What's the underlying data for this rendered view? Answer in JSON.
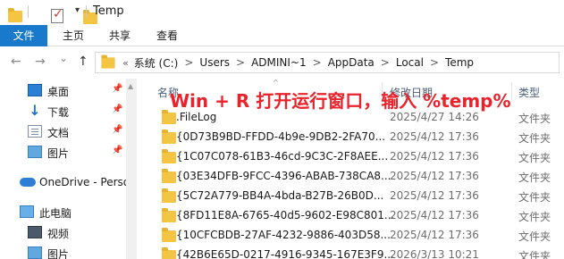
{
  "window": {
    "title": "Temp",
    "qat_dropdown": "▾"
  },
  "ribbon": {
    "tabs": [
      "文件",
      "主页",
      "共享",
      "查看"
    ],
    "active_color": "#1979ca"
  },
  "nav": {
    "back": "←",
    "forward": "→",
    "recent": "⌄",
    "up": "↑"
  },
  "address": {
    "lead": "«",
    "crumbs": [
      "系统 (C:)",
      "Users",
      "ADMINI~1",
      "AppData",
      "Local",
      "Temp"
    ],
    "separator": ">"
  },
  "sidebar": {
    "items": [
      {
        "label": "桌面",
        "icon": "desktop-icon",
        "pinned": true
      },
      {
        "label": "下载",
        "icon": "download-icon",
        "pinned": true
      },
      {
        "label": "文档",
        "icon": "document-icon",
        "pinned": true
      },
      {
        "label": "图片",
        "icon": "picture-icon",
        "pinned": true
      },
      {
        "label": "OneDrive - Perso",
        "icon": "cloud-icon"
      },
      {
        "label": "此电脑",
        "icon": "computer-icon"
      },
      {
        "label": "视频",
        "icon": "video-icon"
      },
      {
        "label": "图片",
        "icon": "picture-icon"
      }
    ],
    "pin_glyph": "📌"
  },
  "columns": {
    "name": "名称",
    "date": "修改日期",
    "type": "类型",
    "sort_glyph": "^"
  },
  "files": [
    {
      "name": ".FileLog",
      "date": "2025/4/27 14:26",
      "type": "文件夹"
    },
    {
      "name": "{0D73B9BD-FFDD-4b9e-9DB2-2FA70...",
      "date": "2025/4/12 17:36",
      "type": "文件夹"
    },
    {
      "name": "{1C07C078-61B3-46cd-9C3C-2F8AEE...",
      "date": "2025/4/12 17:36",
      "type": "文件夹"
    },
    {
      "name": "{03E34DFB-9FCC-4396-ABAB-738CA8...",
      "date": "2025/4/12 17:36",
      "type": "文件夹"
    },
    {
      "name": "{5C72A779-BB4A-4bda-B27B-26B0D...",
      "date": "2025/4/12 17:36",
      "type": "文件夹"
    },
    {
      "name": "{8FD11E8A-6765-40d5-9602-E98C801...",
      "date": "2025/4/12 17:36",
      "type": "文件夹"
    },
    {
      "name": "{10CFCBDB-27AF-4232-9886-403D58...",
      "date": "2025/4/12 17:36",
      "type": "文件夹"
    },
    {
      "name": "{42B6E65D-0217-4916-9345-167E3F9...",
      "date": "2026/3/13 10:21",
      "type": "文件夹"
    }
  ],
  "overlay": {
    "text": "Win + R 打开运行窗口，输入 %temp%",
    "color": "#e8232b"
  },
  "colors": {
    "folder": "#f4c542",
    "header_text": "#4c607a"
  }
}
